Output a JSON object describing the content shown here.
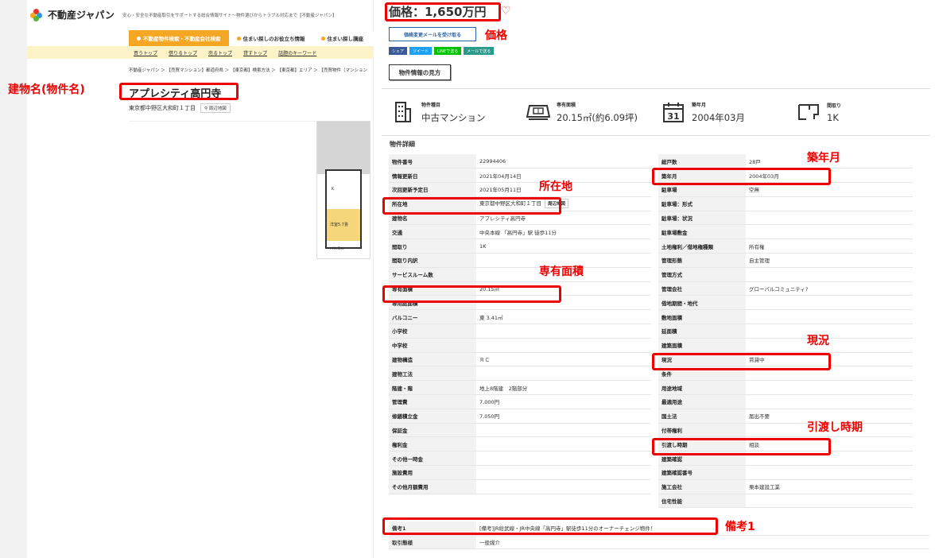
{
  "header": {
    "logo": "不動産ジャパン",
    "tagline": "安心・安全な不動産取引をサポートする総合情報サイト〜物件選びからトラブル対応まで【不動産ジャパン】"
  },
  "nav": [
    "不動産物件検索・不動産会社検索",
    "住まい探しのお役立ち情報",
    "住まい探し講座"
  ],
  "subnav": [
    "買うトップ",
    "借りるトップ",
    "売るトップ",
    "貸すトップ",
    "話題のキーワード"
  ],
  "breadcrumb": "不動産ジャパン ＞ 【売買マンション】都道府県 ＞ 【東京都】検索方法 ＞ 【東京都】エリア ＞ 【売買物件（マンション",
  "building": {
    "name": "アプレシティ高円寺",
    "address": "東京都中野区大和町１丁目",
    "map_btn": "周辺地図"
  },
  "floorplan": {
    "room_label": "洋室5.7畳",
    "balcony": "バルコニー",
    "k": "K"
  },
  "price": "価格：1,650万円",
  "mail_btn": "価格変更メールを受け取る",
  "share": [
    "シェア",
    "ツイート",
    "LINEで送る",
    "メールで送る"
  ],
  "help_btn": "物件情報の見方",
  "summary": [
    {
      "label": "物件種目",
      "value": "中古マンション",
      "icon": "building-icon"
    },
    {
      "label": "専有面積",
      "value": "20.15㎡(約6.09坪)",
      "icon": "floorplan-icon"
    },
    {
      "label": "築年月",
      "value": "2004年03月",
      "icon": "calendar-icon"
    },
    {
      "label": "間取り",
      "value": "1K",
      "icon": "layout-icon"
    }
  ],
  "detail_title": "物件詳細",
  "left_rows": [
    [
      "物件番号",
      "22994406"
    ],
    [
      "情報更新日",
      "2021年04月14日"
    ],
    [
      "次回更新予定日",
      "2021年05月11日"
    ],
    [
      "所在地",
      "東京都中野区大和町１丁目"
    ],
    [
      "建物名",
      "アプレシティ高円寺"
    ],
    [
      "交通",
      "中央本線 「高円寺」駅 徒歩11分"
    ],
    [
      "間取り",
      "1K"
    ],
    [
      "間取り内訳",
      ""
    ],
    [
      "サービスルーム数",
      ""
    ],
    [
      "専有面積",
      "20.15㎡"
    ],
    [
      "専用庭面積",
      ""
    ],
    [
      "バルコニー",
      "東 3.41㎡"
    ],
    [
      "小学校",
      ""
    ],
    [
      "中学校",
      ""
    ],
    [
      "建物構造",
      "ＲＣ"
    ],
    [
      "建物工法",
      ""
    ],
    [
      "階建・階",
      "地上8階建　2階部分"
    ],
    [
      "管理費",
      "7,000円"
    ],
    [
      "修繕積立金",
      "7,050円"
    ],
    [
      "保証金",
      ""
    ],
    [
      "権利金",
      ""
    ],
    [
      "その他一時金",
      ""
    ],
    [
      "施設費用",
      ""
    ],
    [
      "その他月額費用",
      ""
    ]
  ],
  "right_rows": [
    [
      "総戸数",
      "28戸"
    ],
    [
      "築年月",
      "2004年03月"
    ],
    [
      "駐車場",
      "空無"
    ],
    [
      "駐車場：形式",
      ""
    ],
    [
      "駐車場：状況",
      ""
    ],
    [
      "駐車場敷金",
      ""
    ],
    [
      "土地権利／借地権種類",
      "所有権"
    ],
    [
      "管理形態",
      "自主管理"
    ],
    [
      "管理方式",
      ""
    ],
    [
      "管理会社",
      "グローバルコミュニティ?"
    ],
    [
      "借地期間・地代",
      ""
    ],
    [
      "敷地面積",
      ""
    ],
    [
      "延面積",
      ""
    ],
    [
      "建築面積",
      ""
    ],
    [
      "現況",
      "賃貸中"
    ],
    [
      "条件",
      ""
    ],
    [
      "用途地域",
      ""
    ],
    [
      "最適用途",
      ""
    ],
    [
      "国土法",
      "届出不要"
    ],
    [
      "付帯権利",
      ""
    ],
    [
      "引渡し時期",
      "相談"
    ],
    [
      "建築確認",
      ""
    ],
    [
      "建築確認番号",
      ""
    ],
    [
      "施工会社",
      "栗本建設工業"
    ],
    [
      "住宅性能",
      ""
    ]
  ],
  "bottom_rows": [
    [
      "備考1",
      "[備考]JR総武線・JR中央線「高円寺」駅徒歩11分のオーナーチェンジ物件！"
    ],
    [
      "取引態様",
      "一般媒介"
    ]
  ],
  "annotations": {
    "building_name": "建物名(物件名)",
    "price": "価格",
    "location": "所在地",
    "area": "専有面積",
    "built": "築年月",
    "status": "現況",
    "handover": "引渡し時期",
    "remarks": "備考1"
  }
}
